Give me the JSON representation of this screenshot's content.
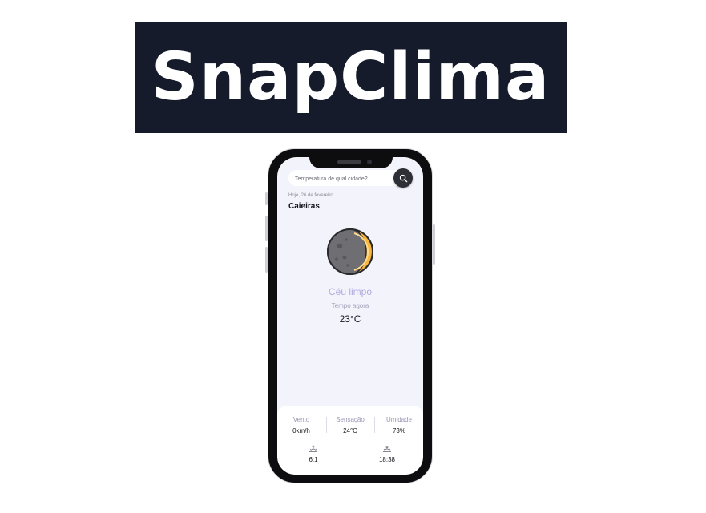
{
  "banner": {
    "title": "SnapClima"
  },
  "search": {
    "placeholder": "Temperatura de qual cidade?"
  },
  "location": {
    "date": "Hoje, 26 de fevereiro",
    "city": "Caieiras"
  },
  "weather": {
    "icon": "moon-icon",
    "condition": "Céu limpo",
    "time_label": "Tempo agora",
    "temperature": "23°C"
  },
  "details": {
    "wind": {
      "label": "Vento",
      "value": "0km/h"
    },
    "feels_like": {
      "label": "Sensação",
      "value": "24°C"
    },
    "humidity": {
      "label": "Umidade",
      "value": "73%"
    },
    "sunrise": {
      "icon": "sunrise-icon",
      "value": "6:1"
    },
    "sunset": {
      "icon": "sunset-icon",
      "value": "18:38"
    }
  },
  "colors": {
    "banner_bg": "#151b2b",
    "screen_bg": "#f3f3fb",
    "accent_lavender": "#b0abe0",
    "moon_gold": "#f6b73c"
  }
}
